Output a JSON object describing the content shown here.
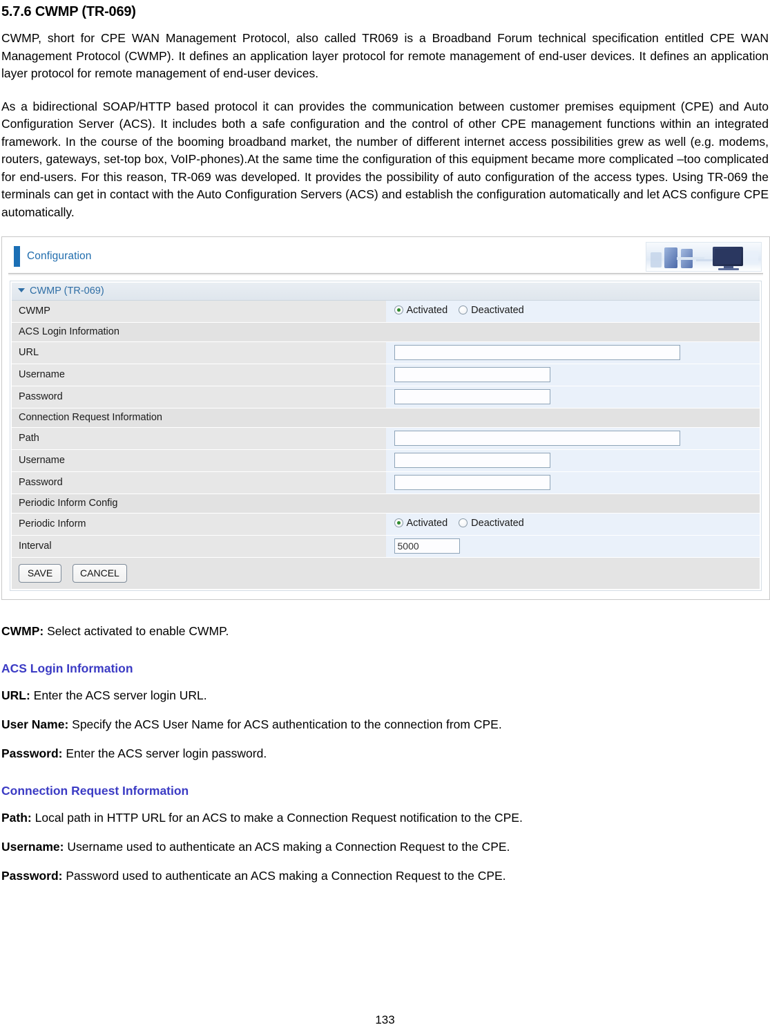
{
  "document": {
    "section_number_title": "5.7.6 CWMP (TR-069)",
    "paragraph_1": "CWMP, short for CPE WAN Management Protocol, also called TR069 is a Broadband Forum technical specification entitled CPE WAN Management Protocol (CWMP). It defines an application layer protocol for remote management of end-user devices. It defines an application layer protocol for remote management of end-user devices.",
    "paragraph_2": "As a bidirectional SOAP/HTTP based protocol it can provides the communication between customer premises equipment (CPE) and Auto Configuration Server (ACS). It includes both a safe configuration and the control of other CPE management functions within an integrated framework. In the course of the booming broadband market, the number of different internet access possibilities grew as well (e.g. modems, routers, gateways, set-top box, VoIP-phones).At the same time the configuration of this equipment became more complicated –too complicated for end-users. For this reason, TR-069 was developed. It provides the possibility of auto configuration of the access types. Using TR-069 the terminals can get in contact with the Auto Configuration Servers (ACS) and establish the configuration automatically and let ACS configure CPE automatically.",
    "page_number": "133"
  },
  "ui": {
    "header_title": "Configuration",
    "panel_title": "CWMP (TR-069)",
    "rows": [
      {
        "kind": "data",
        "label": "CWMP",
        "control": "radio",
        "options": [
          "Activated",
          "Deactivated"
        ],
        "selected": "Activated"
      },
      {
        "kind": "group",
        "label": "ACS Login Information"
      },
      {
        "kind": "data",
        "label": "URL",
        "control": "text",
        "value": "",
        "width": "wide"
      },
      {
        "kind": "data",
        "label": "Username",
        "control": "text",
        "value": "",
        "width": "mid"
      },
      {
        "kind": "data",
        "label": "Password",
        "control": "text",
        "value": "",
        "width": "mid"
      },
      {
        "kind": "group",
        "label": "Connection Request Information"
      },
      {
        "kind": "data",
        "label": "Path",
        "control": "text",
        "value": "",
        "width": "wide"
      },
      {
        "kind": "data",
        "label": "Username",
        "control": "text",
        "value": "",
        "width": "mid"
      },
      {
        "kind": "data",
        "label": "Password",
        "control": "text",
        "value": "",
        "width": "mid"
      },
      {
        "kind": "group",
        "label": "Periodic Inform Config"
      },
      {
        "kind": "data",
        "label": "Periodic Inform",
        "control": "radio",
        "options": [
          "Activated",
          "Deactivated"
        ],
        "selected": "Activated"
      },
      {
        "kind": "data",
        "label": "Interval",
        "control": "text",
        "value": "5000",
        "width": "small"
      }
    ],
    "buttons": {
      "save_label": "SAVE",
      "cancel_label": "CANCEL"
    },
    "colors": {
      "accent_blue": "#1b6fb5",
      "header_text": "#1f6cad",
      "panel_bar_text": "#2f6ea5",
      "label_cell": "#e7e7e7",
      "value_cell": "#eaf1fa",
      "group_cell": "#e2e2e2",
      "radio_selected_dot": "#2f8a2f"
    }
  },
  "descriptions": {
    "cwmp": {
      "term": "CWMP:",
      "text": " Select activated to enable CWMP."
    },
    "acs_heading": "ACS Login Information",
    "acs_items": [
      {
        "term": "URL:",
        "text": " Enter the ACS server login URL."
      },
      {
        "term": "User Name:",
        "text": " Specify the ACS User Name for ACS authentication to the connection from CPE."
      },
      {
        "term": "Password:",
        "text": " Enter the ACS server login password."
      }
    ],
    "conn_heading": "Connection Request Information",
    "conn_items": [
      {
        "term": "Path:",
        "text": " Local path in HTTP URL for an ACS to make a Connection Request notification to the CPE."
      },
      {
        "term": "Username:",
        "text": " Username used to authenticate an ACS making a Connection Request to the CPE."
      },
      {
        "term": "Password:",
        "text": " Password used to authenticate an ACS making a Connection Request to the CPE."
      }
    ]
  }
}
